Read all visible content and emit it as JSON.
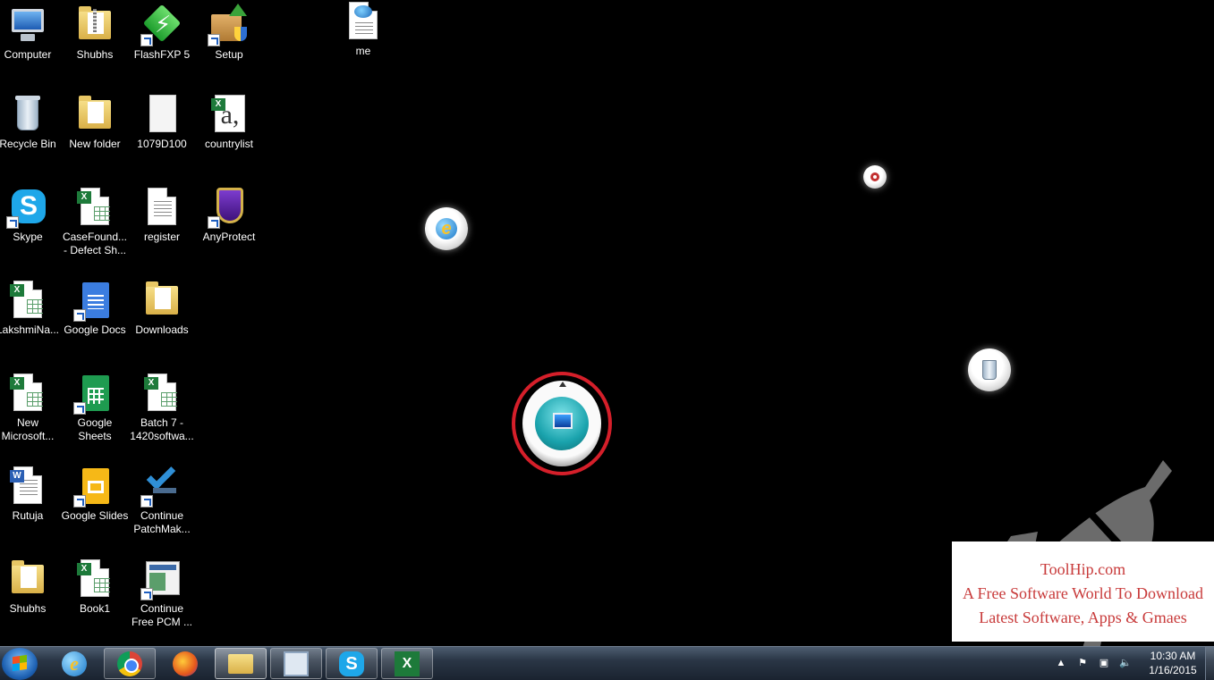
{
  "desktop": {
    "icons": [
      {
        "label": "Computer",
        "icon": "computer-icon"
      },
      {
        "label": "Shubhs",
        "icon": "zip-folder-icon"
      },
      {
        "label": "FlashFXP 5",
        "icon": "flashfxp-icon"
      },
      {
        "label": "Setup",
        "icon": "setup-icon"
      },
      {
        "label": "me",
        "icon": "html-file-icon"
      },
      {
        "label": "Recycle Bin",
        "icon": "recycle-bin-icon"
      },
      {
        "label": "New folder",
        "icon": "folder-icon"
      },
      {
        "label": "1079D100",
        "icon": "blank-file-icon"
      },
      {
        "label": "countrylist",
        "icon": "excel-text-icon"
      },
      {
        "label": "Skype",
        "icon": "skype-icon"
      },
      {
        "label": "CaseFound... - Defect Sh...",
        "icon": "excel-file-icon"
      },
      {
        "label": "register",
        "icon": "text-file-icon"
      },
      {
        "label": "AnyProtect",
        "icon": "shield-icon"
      },
      {
        "label": "LakshmiNa...",
        "icon": "excel-file-icon"
      },
      {
        "label": "Google Docs",
        "icon": "google-docs-icon"
      },
      {
        "label": "Downloads",
        "icon": "folder-icon"
      },
      {
        "label": "New Microsoft...",
        "icon": "excel-file-icon"
      },
      {
        "label": "Google Sheets",
        "icon": "google-sheets-icon"
      },
      {
        "label": "Batch 7 - 1420softwa...",
        "icon": "excel-file-icon"
      },
      {
        "label": "Rutuja",
        "icon": "word-file-icon"
      },
      {
        "label": "Google Slides",
        "icon": "google-slides-icon"
      },
      {
        "label": "Continue PatchMak...",
        "icon": "checkmark-icon"
      },
      {
        "label": "Shubhs",
        "icon": "folder-icon"
      },
      {
        "label": "Book1",
        "icon": "excel-file-icon"
      },
      {
        "label": "Continue Free PCM ...",
        "icon": "window-app-icon"
      }
    ]
  },
  "watermark": {
    "line1": "ToolHip.com",
    "line2": "A Free Software World To Download",
    "line3": "Latest Software, Apps & Gmaes"
  },
  "taskbar": {
    "items": [
      {
        "name": "start-button",
        "icon": "windows-flag-icon"
      },
      {
        "name": "internet-explorer",
        "icon": "ie-icon"
      },
      {
        "name": "chrome",
        "icon": "chrome-icon"
      },
      {
        "name": "firefox",
        "icon": "firefox-icon"
      },
      {
        "name": "windows-explorer",
        "icon": "folder-icon"
      },
      {
        "name": "remote-desktop",
        "icon": "remote-desktop-icon"
      },
      {
        "name": "skype",
        "icon": "skype-icon"
      },
      {
        "name": "excel",
        "icon": "excel-icon"
      }
    ],
    "clock": {
      "time": "10:30 AM",
      "date": "1/16/2015"
    }
  },
  "colors": {
    "desktop_bg": "#000000",
    "highlight_ring": "#d51f2a",
    "watermark_text": "#c83a3a"
  }
}
